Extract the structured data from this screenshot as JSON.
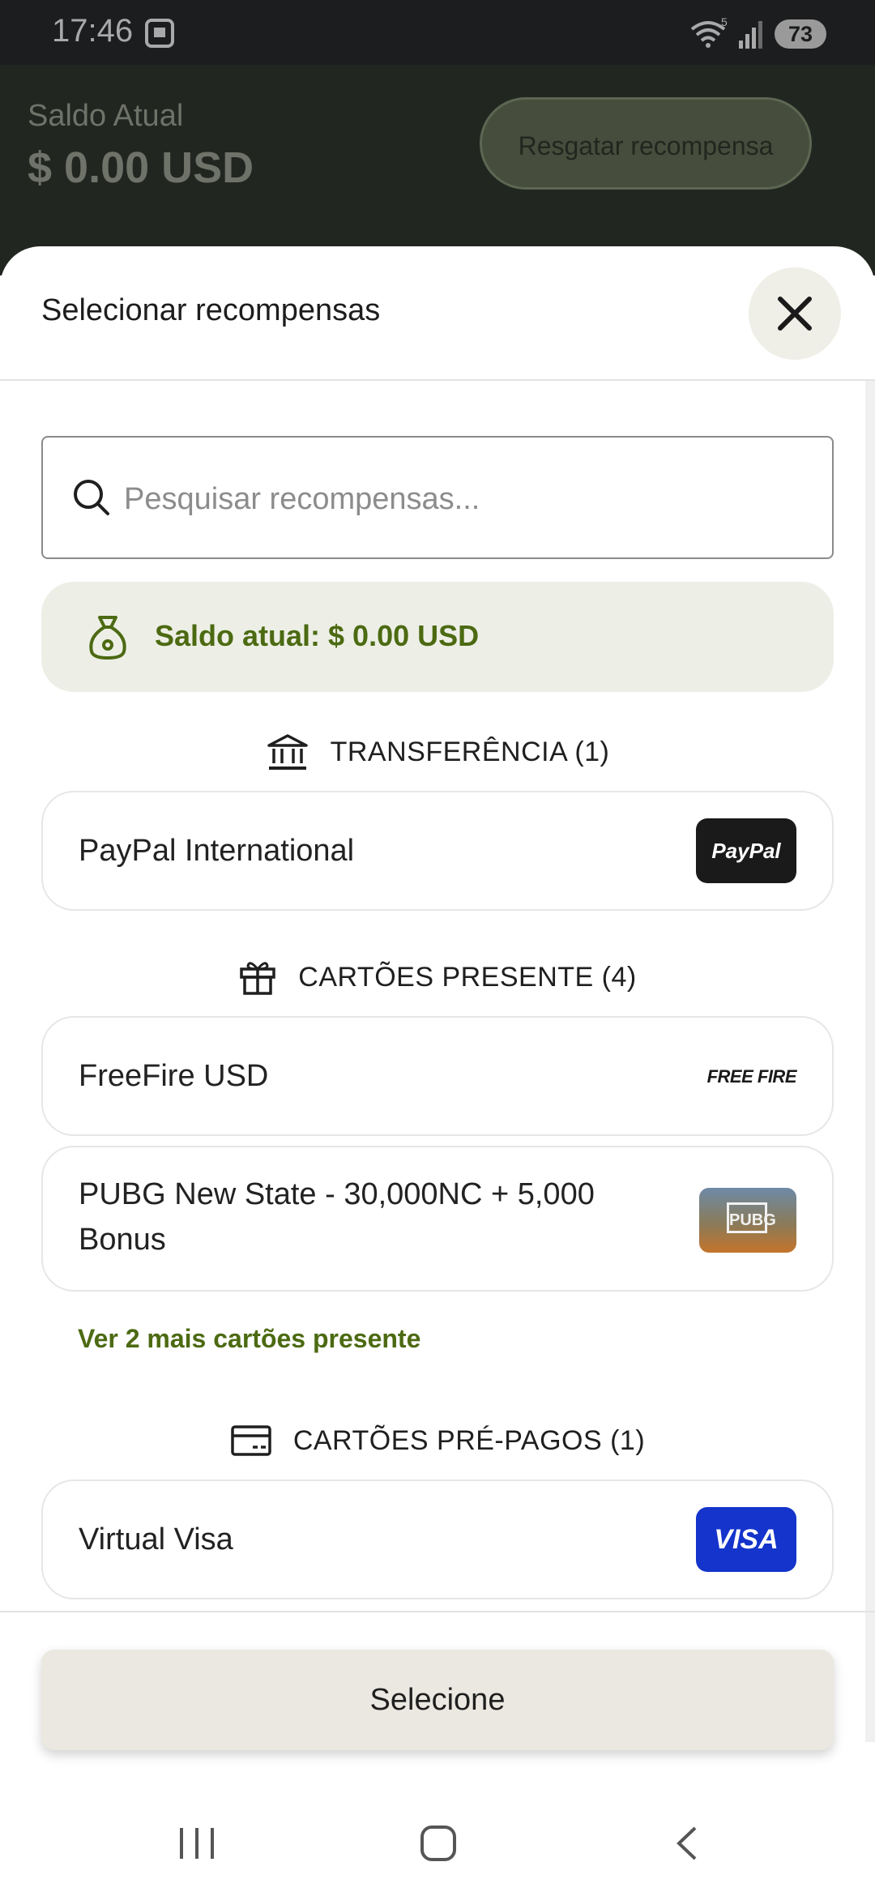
{
  "status_bar": {
    "time": "17:46",
    "battery": "73",
    "wifi_badge": "5"
  },
  "app_header": {
    "balance_label": "Saldo Atual",
    "balance_value": "$ 0.00 USD",
    "redeem_button": "Resgatar recompensa"
  },
  "sheet": {
    "title": "Selecionar recompensas",
    "search_placeholder": "Pesquisar recompensas...",
    "balance_text": "Saldo atual: $ 0.00 USD",
    "sections": {
      "transfer": {
        "title": "TRANSFERÊNCIA (1)",
        "icon": "bank-icon"
      },
      "gift_cards": {
        "title": "CARTÕES PRESENTE (4)",
        "icon": "gift-icon"
      },
      "prepaid": {
        "title": "CARTÕES PRÉ-PAGOS (1)",
        "icon": "card-icon"
      }
    },
    "items": {
      "paypal": {
        "name": "PayPal International",
        "logo_text": "PayPal"
      },
      "freefire": {
        "name": "FreeFire USD",
        "logo_text": "FREE FIRE"
      },
      "pubg": {
        "name": "PUBG New State - 30,000NC + 5,000 Bonus",
        "logo_text": "PUBG"
      },
      "visa": {
        "name": "Virtual Visa",
        "logo_text": "VISA"
      }
    },
    "more_gift_cards_link": "Ver 2 mais cartões presente",
    "select_button": "Selecione"
  },
  "colors": {
    "accent_green": "#4c6a12",
    "paypal_bg": "#1a1a1a",
    "visa_bg": "#1434cb"
  }
}
